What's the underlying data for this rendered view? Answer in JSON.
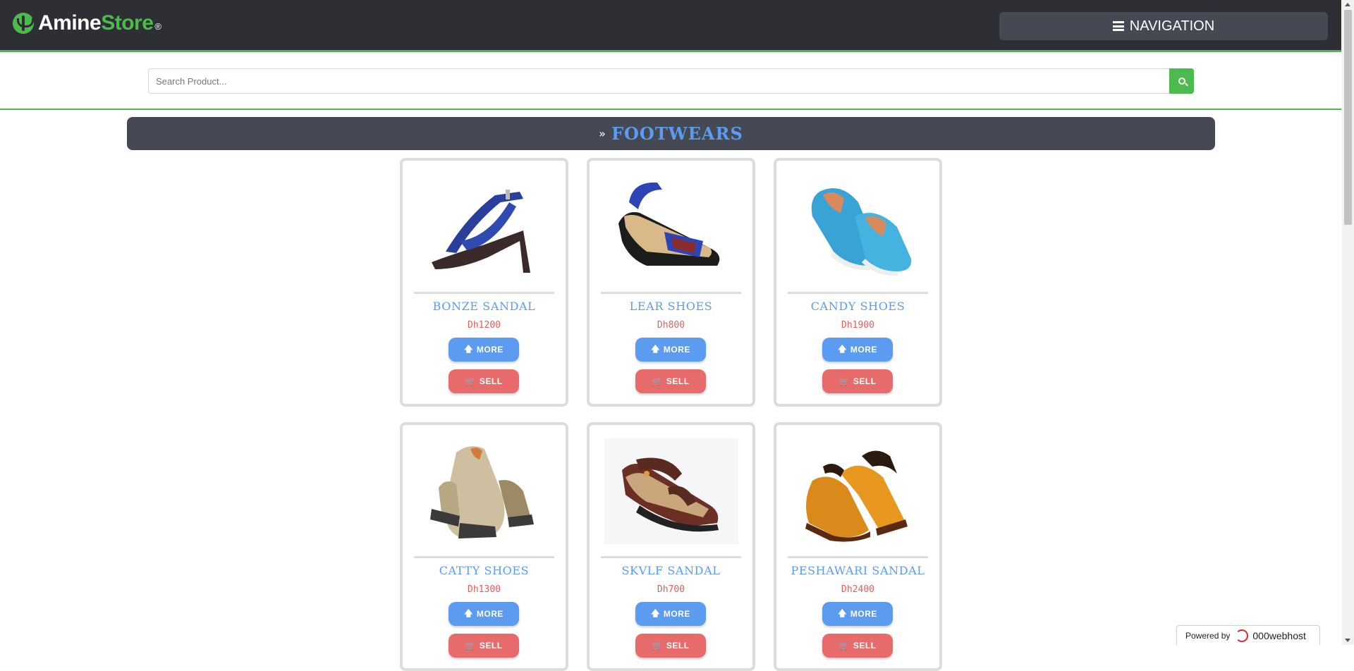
{
  "header": {
    "logo_part1": "Amine",
    "logo_part2": "Store",
    "logo_reg": "®",
    "nav_label": "NAVIGATION"
  },
  "search": {
    "placeholder": "Search Product..."
  },
  "category": {
    "title": "FOOTWEARS"
  },
  "buttons": {
    "more": "MORE",
    "sell": "SELL"
  },
  "products": [
    {
      "name": "BONZE SANDAL",
      "price": "Dh1200",
      "icon": "blue-strappy-heel"
    },
    {
      "name": "LEAR SHOES",
      "price": "Dh800",
      "icon": "wedge-sandal"
    },
    {
      "name": "CANDY SHOES",
      "price": "Dh1900",
      "icon": "blue-slip-on-shoes"
    },
    {
      "name": "CATTY SHOES",
      "price": "Dh1300",
      "icon": "beige-hiking-shoes"
    },
    {
      "name": "SKVLF SANDAL",
      "price": "Dh700",
      "icon": "brown-sport-sandal"
    },
    {
      "name": "PESHAWARI SANDAL",
      "price": "Dh2400",
      "icon": "orange-peshawari-sandal"
    }
  ],
  "footer": {
    "powered_by": "Powered by",
    "host": "000webhost"
  },
  "colors": {
    "topbar": "#2d2f34",
    "accent_green": "#4cba4c",
    "panel": "#444953",
    "link_blue": "#5b9bf0",
    "price_red": "#e85b5b"
  }
}
